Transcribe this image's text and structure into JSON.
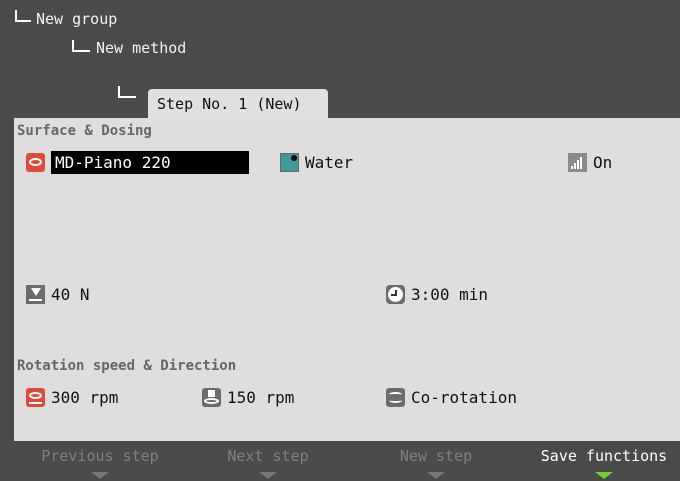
{
  "tree": {
    "group": "New group",
    "method": "New method",
    "step": "Step No. 1 (New)"
  },
  "surface": {
    "heading": "Surface & Dosing",
    "disc": {
      "icon": "disc-icon",
      "value": "MD-Piano 220"
    },
    "lubricant": {
      "icon": "water-icon",
      "value": "Water"
    },
    "dosing": {
      "icon": "signal-level-icon",
      "value": "On"
    },
    "force": {
      "icon": "force-icon",
      "value": "40 N"
    },
    "time": {
      "icon": "clock-icon",
      "value": "3:00 min"
    }
  },
  "rotation": {
    "heading": "Rotation speed & Direction",
    "disc_speed": {
      "icon": "disc-rotation-icon",
      "value": "300 rpm"
    },
    "head_speed": {
      "icon": "head-rotation-icon",
      "value": "150 rpm"
    },
    "direction": {
      "icon": "direction-icon",
      "value": "Co-rotation"
    }
  },
  "footer": {
    "buttons": [
      {
        "label": "Previous step",
        "enabled": false
      },
      {
        "label": "Next step",
        "enabled": false
      },
      {
        "label": "New step",
        "enabled": false
      },
      {
        "label": "Save functions",
        "enabled": true
      }
    ]
  },
  "colors": {
    "background": "#4a4a4a",
    "panel": "#dedede",
    "accent": "#6fcf2c",
    "disc_red": "#e04a3a"
  }
}
